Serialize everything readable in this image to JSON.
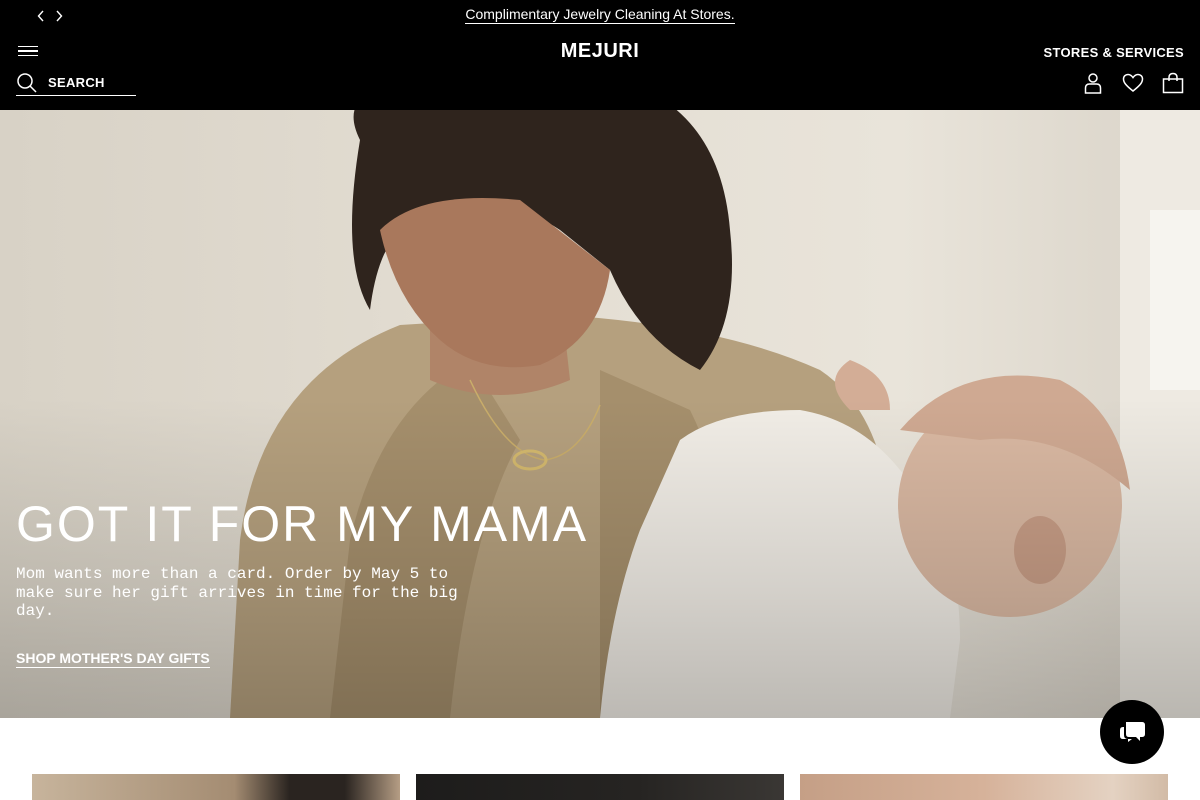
{
  "announcement": {
    "text": "Complimentary Jewelry Cleaning At Stores."
  },
  "header": {
    "logo": "MEJURI",
    "stores_link": "STORES & SERVICES",
    "search_label": "SEARCH"
  },
  "hero": {
    "title": "GOT IT FOR MY MAMA",
    "subtitle": "Mom wants more than a card. Order by May 5 to make sure her gift arrives in time for the big day.",
    "cta": "SHOP MOTHER'S DAY GIFTS"
  },
  "colors": {
    "header_bg": "#000000",
    "text_on_dark": "#ffffff",
    "hero_bg": "#e3ddd2",
    "chat_bg": "#000000"
  },
  "icons": {
    "prev": "chevron-left-icon",
    "next": "chevron-right-icon",
    "menu": "menu-icon",
    "search": "search-icon",
    "account": "user-icon",
    "wishlist": "heart-icon",
    "bag": "shopping-bag-icon",
    "chat": "chat-icon"
  }
}
